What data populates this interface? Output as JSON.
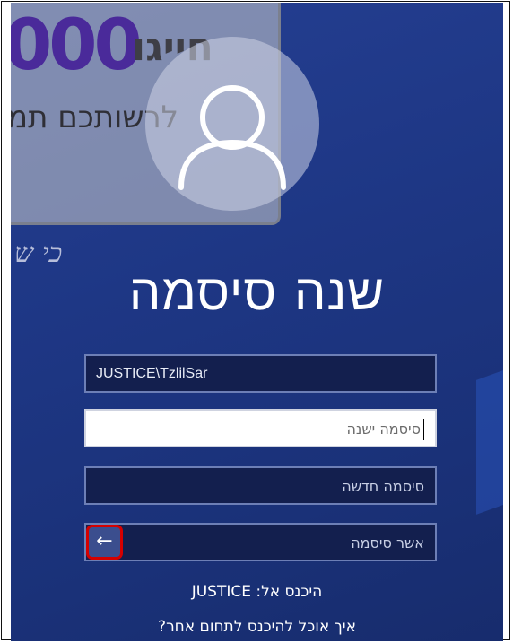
{
  "background": {
    "big_number": "000",
    "word": "חייגו",
    "subtitle": "לרשותכם תמ",
    "script_text": "כי ש"
  },
  "avatar": {
    "icon": "user-icon"
  },
  "title": "שנה סיסמה",
  "fields": {
    "username": {
      "value": "JUSTICE\\TzlilSar"
    },
    "old_password": {
      "placeholder": "סיסמה ישנה"
    },
    "new_password": {
      "placeholder": "סיסמה חדשה"
    },
    "confirm_password": {
      "placeholder": "אשר סיסמה"
    }
  },
  "submit": {
    "icon": "arrow-right-icon",
    "glyph": "←"
  },
  "domain_text": "היכנס אל: JUSTICE",
  "other_domain_link": "איך אוכל להיכנס לתחום אחר?",
  "colors": {
    "screen_background": "#1e3785",
    "field_background": "#131f4e",
    "field_border": "#6d7fb6",
    "highlight_box": "#d50000",
    "text": "#ffffff"
  }
}
